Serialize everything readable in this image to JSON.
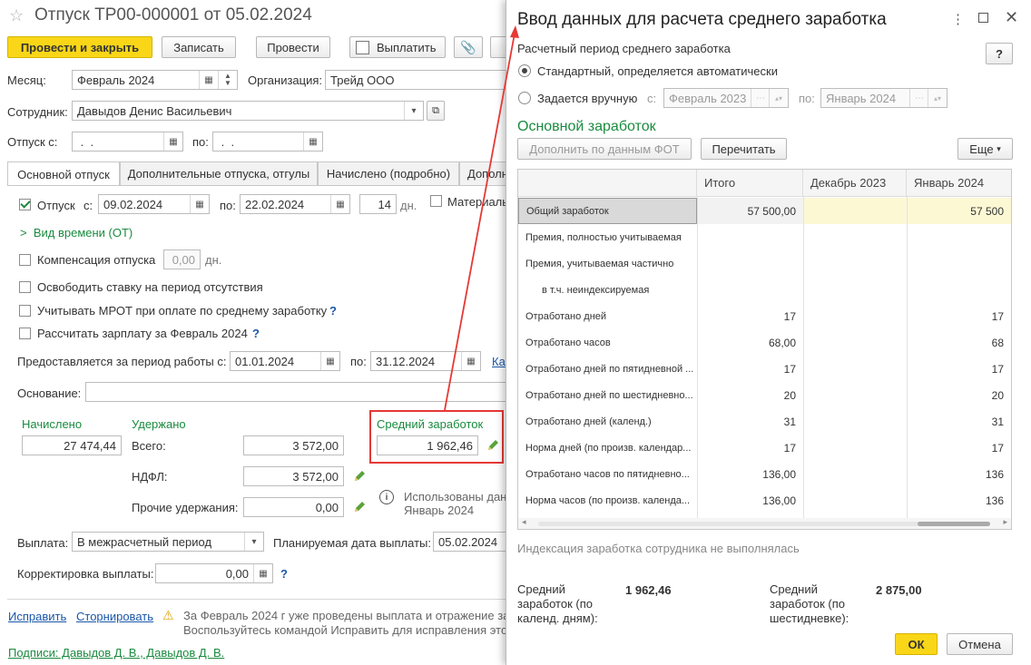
{
  "doc": {
    "title": "Отпуск ТР00-000001 от 05.02.2024",
    "toolbar": {
      "post_close": "Провести и закрыть",
      "save": "Записать",
      "post": "Провести",
      "pay": "Выплатить"
    },
    "month_label": "Месяц:",
    "month_value": "Февраль 2024",
    "org_label": "Организация:",
    "org_value": "Трейд ООО",
    "employee_label": "Сотрудник:",
    "employee_value": "Давыдов Денис Васильевич",
    "vacation_from_label": "Отпуск с:",
    "vacation_from_value": " .  .",
    "vacation_to_label": "по:",
    "vacation_to_value": " .  .",
    "tabs": [
      "Основной отпуск",
      "Дополнительные отпуска, отгулы",
      "Начислено (подробно)",
      "Дополн"
    ],
    "main_vacation_label": "Отпуск",
    "from_label": "с:",
    "from_value": "09.02.2024",
    "to_label": "по:",
    "to_value": "22.02.2024",
    "days_value": "14",
    "days_unit": "дн.",
    "material_label": "Материаль",
    "time_type_link": "Вид времени (ОТ)",
    "compensation_label": "Компенсация отпуска",
    "compensation_value": "0,00",
    "compensation_unit": "дн.",
    "free_rate_label": "Освободить ставку на период отсутствия",
    "mrot_label": "Учитывать МРОТ при оплате по среднему заработку",
    "calc_salary_label": "Рассчитать зарплату за Февраль 2024",
    "work_period_label": "Предоставляется за период работы с:",
    "work_from": "01.01.2024",
    "work_to_label": "по:",
    "work_to": "31.12.2024",
    "work_link": "Ка",
    "basis_label": "Основание:",
    "accrued_label": "Начислено",
    "accrued_value": "27 474,44",
    "withheld_label": "Удержано",
    "total_label": "Всего:",
    "total_value": "3 572,00",
    "ndfl_label": "НДФЛ:",
    "ndfl_value": "3 572,00",
    "other_label": "Прочие удержания:",
    "other_value": "0,00",
    "avg_label": "Средний заработок",
    "avg_value": "1 962,46",
    "info_text_1": "Использованы дан",
    "info_text_2": "Январь 2024",
    "payment_label": "Выплата:",
    "payment_value": "В межрасчетный период",
    "planned_date_label": "Планируемая дата выплаты:",
    "planned_date_value": "05.02.2024",
    "correction_label": "Корректировка выплаты:",
    "correction_value": "0,00",
    "fix_link": "Исправить",
    "storno_link": "Сторнировать",
    "warning_1": "За Февраль 2024 г уже проведены выплата и отражение за",
    "warning_2": "Воспользуйтесь командой Исправить для исправления это",
    "signatures_link": "Подписи: Давыдов Д. В., Давыдов Д. В."
  },
  "dialog": {
    "title": "Ввод данных для расчета среднего заработка",
    "period_label": "Расчетный период среднего заработка",
    "help_btn": "?",
    "radio_standard": "Стандартный, определяется автоматически",
    "radio_manual": "Задается вручную",
    "manual_from_label": "с:",
    "manual_from": "Февраль 2023",
    "manual_to_label": "по:",
    "manual_to": "Январь 2024",
    "section_title": "Основной заработок",
    "fill_btn": "Дополнить по данным ФОТ",
    "recalc_btn": "Перечитать",
    "more_btn": "Еще",
    "columns": [
      "",
      "Итого",
      "Декабрь 2023",
      "Январь 2024"
    ],
    "rows": [
      {
        "name": "Общий заработок",
        "total": "57 500,00",
        "dec": "",
        "jan": "57 500"
      },
      {
        "name": "Премия, полностью учитываемая",
        "total": "",
        "dec": "",
        "jan": ""
      },
      {
        "name": "Премия, учитываемая частично",
        "total": "",
        "dec": "",
        "jan": ""
      },
      {
        "name": "в т.ч. неиндексируемая",
        "total": "",
        "dec": "",
        "jan": ""
      },
      {
        "name": "Отработано дней",
        "total": "17",
        "dec": "",
        "jan": "17"
      },
      {
        "name": "Отработано часов",
        "total": "68,00",
        "dec": "",
        "jan": "68"
      },
      {
        "name": "Отработано дней по пятидневной ...",
        "total": "17",
        "dec": "",
        "jan": "17"
      },
      {
        "name": "Отработано дней по шестидневно...",
        "total": "20",
        "dec": "",
        "jan": "20"
      },
      {
        "name": "Отработано дней (календ.)",
        "total": "31",
        "dec": "",
        "jan": "31"
      },
      {
        "name": "Норма дней (по произв. календар...",
        "total": "17",
        "dec": "",
        "jan": "17"
      },
      {
        "name": "Отработано часов по пятидневно...",
        "total": "136,00",
        "dec": "",
        "jan": "136"
      },
      {
        "name": "Норма часов (по произв. календа...",
        "total": "136,00",
        "dec": "",
        "jan": "136"
      }
    ],
    "indexation_note": "Индексация заработка сотрудника не выполнялась",
    "avg_cal_label_1": "Средний",
    "avg_cal_label_2": "заработок (по",
    "avg_cal_label_3": "календ. дням):",
    "avg_cal_value": "1 962,46",
    "avg_six_label_1": "Средний",
    "avg_six_label_2": "заработок (по",
    "avg_six_label_3": "шестидневке):",
    "avg_six_value": "2 875,00",
    "ok_btn": "ОК",
    "cancel_btn": "Отмена"
  },
  "colors": {
    "accent_yellow": "#f9d617",
    "green": "#1a8b3f",
    "link": "#1a57a8",
    "highlight_red": "#e53935",
    "yellow_cell": "#fdf8d4"
  }
}
